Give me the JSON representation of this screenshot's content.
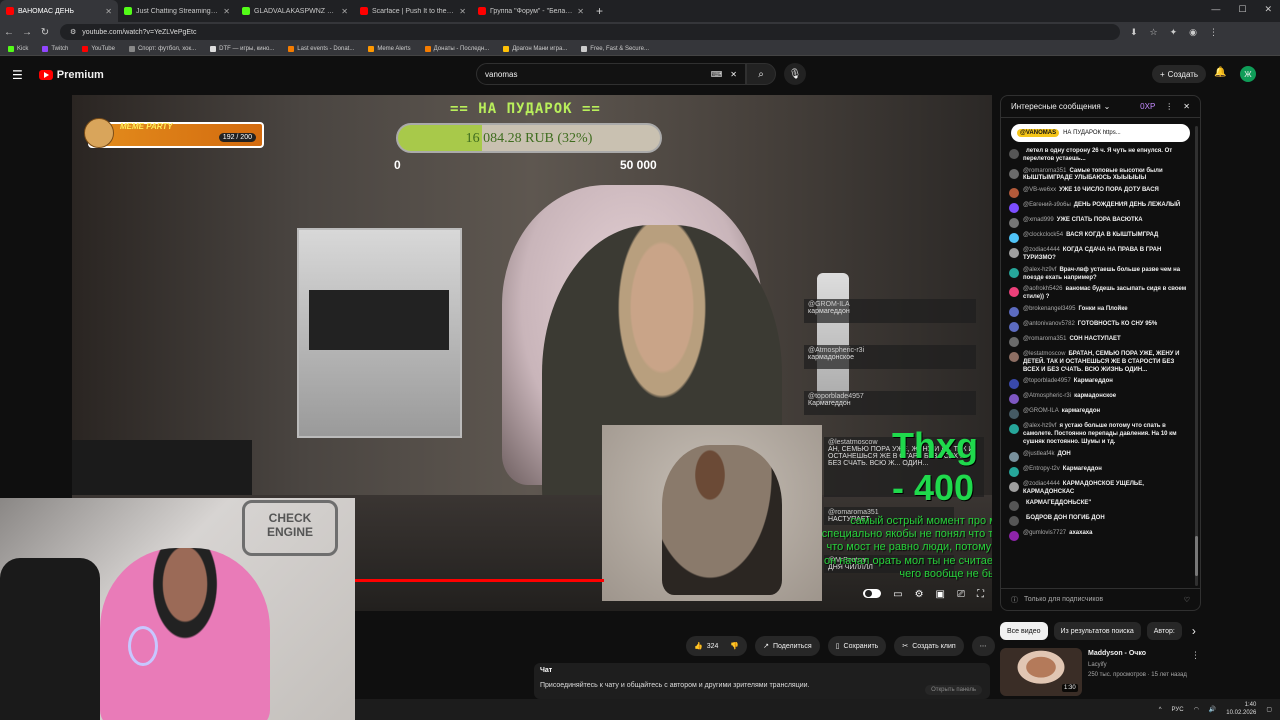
{
  "browser": {
    "tabs": [
      {
        "title": "ВАНОМАС ДЕНЬ",
        "color": "#ff0000",
        "active": true
      },
      {
        "title": "Just Chatting Streaming - Live",
        "color": "#53fc18",
        "active": false
      },
      {
        "title": "GLADVALAKASPWNZ Stream",
        "color": "#53fc18",
        "active": false
      },
      {
        "title": "Scarface | Push It to the Limit",
        "color": "#ff0000",
        "active": false
      },
      {
        "title": "Группа \"Форум\" - \"Белая ночь\"",
        "color": "#ff0000",
        "active": false
      }
    ],
    "url": "youtube.com/watch?v=YeZLVePgEtc",
    "bookmarks": [
      {
        "label": "Kick",
        "color": "#53fc18"
      },
      {
        "label": "Twitch",
        "color": "#9146ff"
      },
      {
        "label": "YouTube",
        "color": "#ff0000"
      },
      {
        "label": "Спорт: футбол, хок...",
        "color": "#888888"
      },
      {
        "label": "DTF — игры, кино...",
        "color": "#dddddd"
      },
      {
        "label": "Last events - Donat...",
        "color": "#f57c00"
      },
      {
        "label": "Meme Alerts",
        "color": "#ff9800"
      },
      {
        "label": "Донаты - Последн...",
        "color": "#f57c00"
      },
      {
        "label": "Драгон Мани игра...",
        "color": "#ffc107"
      },
      {
        "label": "Free, Fast & Secure...",
        "color": "#cccccc"
      }
    ]
  },
  "youtube": {
    "logo_label": "Premium",
    "search_value": "vanomas",
    "create_label": "Создать",
    "avatar_letter": "Ж"
  },
  "overlay": {
    "meme_party_title": "MEME PARTY",
    "meme_party_count": "192 / 200",
    "donate_title": "== НА ПУДАРОК ==",
    "donate_amount": "16 084.28 RUB (32%)",
    "donate_progress": 0.32,
    "donate_min": "0",
    "donate_max": "50 000",
    "thxg": "Thxg - 400",
    "green_text": "самый острый момент про мост водолаз специально якобы не понял что ты имел ввиду а то что мост не равно люди, потому что это здание, а он начал орать мол ты не считаешь крым русским, чего вообще не было",
    "chat_cards": [
      {
        "user": "@GROM-ILA",
        "text": "кармагеддон"
      },
      {
        "user": "@Atmospheric-r3i",
        "text": "кармадонское"
      },
      {
        "user": "@toporblade4957",
        "text": "Кармагеддон"
      },
      {
        "user": "@lestatmoscow",
        "text": "АН, СЕМЬЮ ПОРА УЖЕ, ЖЕНУ И Д... ТАК И ОСТАНЕШЬСЯ ЖЕ В СТАР... БЕЗ ВСЕХ И БЕЗ СЧАТЬ. ВСЮ Ж... ОДИН..."
      },
      {
        "user": "@romaroma351",
        "text": "НАСТУПАЕТ"
      },
      {
        "user": "@MrBoatsan",
        "text": "ДНЯ ЧИЛЛЛЛ"
      }
    ],
    "webcam_sign": "CHECK ENGINE"
  },
  "live_chat": {
    "header": "Интересные сообщения",
    "points": "0XP",
    "pinned_user": "@VANOMAS",
    "pinned_text": "НА ПУДАРОК https...",
    "messages": [
      {
        "user": "",
        "text": "летел в одну сторону 26 ч. Я чуть не епнулся. От перелетов устаешь...",
        "color": "#555555"
      },
      {
        "user": "@romaroma351",
        "text": "Самые топовые высотки были КЫШТЫМГРАДЕ УЛЫБАЮСЬ ХЫЫЫЫЫ",
        "color": "#6a6a6a"
      },
      {
        "user": "@VB-we6xx",
        "text": "УЖЕ 10 ЧИСЛО ПОРА ДОТУ ВАСЯ",
        "color": "#b35a3a"
      },
      {
        "user": "@Евгений-з9о6ы",
        "text": "ДЕНЬ РОЖДЕНИЯ ДЕНЬ ЛЕЖАЛЫЙ",
        "color": "#7c4dff"
      },
      {
        "user": "@xmad999",
        "text": "УЖЕ СПАТЬ ПОРА ВАСЮТКА",
        "color": "#757575"
      },
      {
        "user": "@clockclock54",
        "text": "ВАСЯ КОГДА В КЫШТЫМГРАД",
        "color": "#4fc3f7"
      },
      {
        "user": "@zodiac4444",
        "text": "КОГДА СДАЧА НА ПРАВА В ГРАН ТУРИЗМО?",
        "color": "#9e9e9e"
      },
      {
        "user": "@alex-hz9vf",
        "text": "Врач-лвф устаешь больше разве чем на поезде ехать например?",
        "color": "#26a69a"
      },
      {
        "user": "@aofrokh5426",
        "text": "ваномас будешь засыпать сидя в своем стиле)) ?",
        "color": "#ec407a"
      },
      {
        "user": "@brokenangel3495",
        "text": "Гонки на Плойке",
        "color": "#5c6bc0"
      },
      {
        "user": "@antonivanov5782",
        "text": "ГОТОВНОСТЬ КО СНУ 95%",
        "color": "#5c6bc0"
      },
      {
        "user": "@romaroma351",
        "text": "СОН НАСТУПАЕТ",
        "color": "#6a6a6a"
      },
      {
        "user": "@lestatmoscow",
        "text": "БРАТАН, СЕМЬЮ ПОРА УЖЕ, ЖЕНУ И ДЕТЕЙ. ТАК И ОСТАНЕШЬСЯ ЖЕ В СТАРОСТИ БЕЗ ВСЕХ И БЕЗ СЧАТЬ. ВСЮ ЖИЗНЬ ОДИН...",
        "color": "#8d6e63"
      },
      {
        "user": "@toporblade4957",
        "text": "Кармагеддон",
        "color": "#3949ab"
      },
      {
        "user": "@Atmospheric-r3i",
        "text": "кармадонское",
        "color": "#7e57c2"
      },
      {
        "user": "@GROM-ILA",
        "text": "кармагеддон",
        "color": "#455a64"
      },
      {
        "user": "@alex-hz9vf",
        "text": "я устаю больше потому что спать в самолете. Постоянно перепады давления. На 10 км сушняк постоянно. Шумы и тд.",
        "color": "#26a69a"
      },
      {
        "user": "@justleaf4k",
        "text": "ДОН",
        "color": "#78909c"
      },
      {
        "user": "@Entropy-t2v",
        "text": "Кармагеддон",
        "color": "#26a69a"
      },
      {
        "user": "@zodiac4444",
        "text": "КАРМАДОНСКОЕ УЩЕЛЬЕ, КАРМАДОНСКАС",
        "color": "#9e9e9e"
      },
      {
        "user": "",
        "text": "КАРМАГЕДДОНЬСКЕ\"",
        "color": "#555555"
      },
      {
        "user": "",
        "text": "БОДРОВ ДОН ПОГИБ ДОН",
        "color": "#555555"
      },
      {
        "user": "@gumlovis7727",
        "text": "ахахаха",
        "color": "#8e24aa"
      }
    ],
    "input_placeholder": "Только для подписчиков"
  },
  "actions": {
    "likes": "324",
    "share": "Поделиться",
    "save": "Сохранить",
    "clip": "Создать клип"
  },
  "chat_panel": {
    "title": "Чат",
    "body": "Присоединяйтесь к чату и общайтесь с автором и другими зрителями трансляции.",
    "button": "Открыть панель"
  },
  "recommend": {
    "chips": [
      "Все видео",
      "Из результатов поиска",
      "Автор: "
    ],
    "video_title": "Maddyson - Очко",
    "channel": "Lacyify",
    "meta": "250 тыс. просмотров · 15 лет назад",
    "duration": "1:30"
  },
  "taskbar": {
    "lang": "РУС",
    "time": "1:40",
    "date": "10.02.2026"
  }
}
